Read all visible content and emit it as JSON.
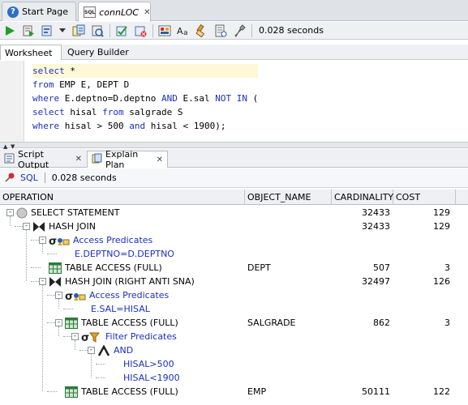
{
  "doc_tabs": [
    {
      "label": "Start Page",
      "icon": "help-icon"
    },
    {
      "label": "connLOC",
      "icon": "sql-worksheet-icon"
    }
  ],
  "toolbar": {
    "elapsed": "0.028 seconds",
    "buttons": [
      "run-statement-icon",
      "run-script-icon",
      "autotrace-icon",
      "dropdown-arrow-icon",
      "explain-plan-icon",
      "sql-tuning-icon",
      "commit-icon",
      "rollback-icon",
      "unshared-sql-icon",
      "to-upper-lower-icon",
      "clear-icon",
      "sql-history-icon",
      "tools-icon"
    ]
  },
  "sub_tabs": [
    "Worksheet",
    "Query Builder"
  ],
  "editor": {
    "lines": [
      [
        {
          "t": "select ",
          "k": true
        },
        {
          "t": "*",
          "k": false
        }
      ],
      [
        {
          "t": "from ",
          "k": true
        },
        {
          "t": "EMP E, DEPT D",
          "k": false
        }
      ],
      [
        {
          "t": "where ",
          "k": true
        },
        {
          "t": "E.deptno=D.deptno ",
          "k": false
        },
        {
          "t": "AND ",
          "k": true
        },
        {
          "t": "E.sal ",
          "k": false
        },
        {
          "t": "NOT IN ",
          "k": true
        },
        {
          "t": "(",
          "k": false
        }
      ],
      [
        {
          "t": "select ",
          "k": true
        },
        {
          "t": "hisal ",
          "k": false
        },
        {
          "t": "from ",
          "k": true
        },
        {
          "t": "salgrade S",
          "k": false
        }
      ],
      [
        {
          "t": "where ",
          "k": true
        },
        {
          "t": "hisal > ",
          "k": false
        },
        {
          "t": "500 ",
          "k": false
        },
        {
          "t": "and ",
          "k": true
        },
        {
          "t": "hisal < ",
          "k": false
        },
        {
          "t": "1900",
          "k": false
        },
        {
          "t": ");",
          "k": false
        }
      ]
    ]
  },
  "output_tabs": [
    {
      "label": "Script Output",
      "icon": "script-output-icon"
    },
    {
      "label": "Explain Plan",
      "icon": "explain-plan-icon"
    }
  ],
  "explain_bar": {
    "sql_label": "SQL",
    "elapsed": "0.028 seconds"
  },
  "plan": {
    "columns": [
      "OPERATION",
      "OBJECT_NAME",
      "CARDINALITY",
      "COST"
    ],
    "rows": [
      {
        "level": 0,
        "icon": "select-statement-icon",
        "op": "SELECT STATEMENT",
        "obj": "",
        "card": "32433",
        "cost": "129",
        "blue": false,
        "toggle": "-"
      },
      {
        "level": 1,
        "icon": "hash-join-icon",
        "op": "HASH JOIN",
        "obj": "",
        "card": "32433",
        "cost": "129",
        "blue": false,
        "toggle": "-"
      },
      {
        "level": 2,
        "icon": "access-predicates-icon",
        "op": "Access Predicates",
        "obj": "",
        "card": "",
        "cost": "",
        "blue": true,
        "toggle": "-"
      },
      {
        "level": 3,
        "icon": "",
        "op": "E.DEPTNO=D.DEPTNO",
        "obj": "",
        "card": "",
        "cost": "",
        "blue": true,
        "toggle": ""
      },
      {
        "level": 2,
        "icon": "table-access-icon",
        "op": "TABLE ACCESS (FULL)",
        "obj": "DEPT",
        "card": "507",
        "cost": "3",
        "blue": false,
        "toggle": ""
      },
      {
        "level": 2,
        "icon": "hash-join-icon",
        "op": "HASH JOIN (RIGHT ANTI SNA)",
        "obj": "",
        "card": "32497",
        "cost": "126",
        "blue": false,
        "toggle": "-"
      },
      {
        "level": 3,
        "icon": "access-predicates-icon",
        "op": "Access Predicates",
        "obj": "",
        "card": "",
        "cost": "",
        "blue": true,
        "toggle": "-"
      },
      {
        "level": 4,
        "icon": "",
        "op": "E.SAL=HISAL",
        "obj": "",
        "card": "",
        "cost": "",
        "blue": true,
        "toggle": ""
      },
      {
        "level": 3,
        "icon": "table-access-icon",
        "op": "TABLE ACCESS (FULL)",
        "obj": "SALGRADE",
        "card": "862",
        "cost": "3",
        "blue": false,
        "toggle": "-"
      },
      {
        "level": 4,
        "icon": "filter-predicates-icon",
        "op": "Filter Predicates",
        "obj": "",
        "card": "",
        "cost": "",
        "blue": true,
        "toggle": "-"
      },
      {
        "level": 5,
        "icon": "and-icon",
        "op": "AND",
        "obj": "",
        "card": "",
        "cost": "",
        "blue": true,
        "toggle": "-"
      },
      {
        "level": 6,
        "icon": "",
        "op": "HISAL>500",
        "obj": "",
        "card": "",
        "cost": "",
        "blue": true,
        "toggle": ""
      },
      {
        "level": 6,
        "icon": "",
        "op": "HISAL<1900",
        "obj": "",
        "card": "",
        "cost": "",
        "blue": true,
        "toggle": ""
      },
      {
        "level": 3,
        "icon": "table-access-icon",
        "op": "TABLE ACCESS (FULL)",
        "obj": "EMP",
        "card": "50111",
        "cost": "122",
        "blue": false,
        "toggle": ""
      }
    ]
  }
}
